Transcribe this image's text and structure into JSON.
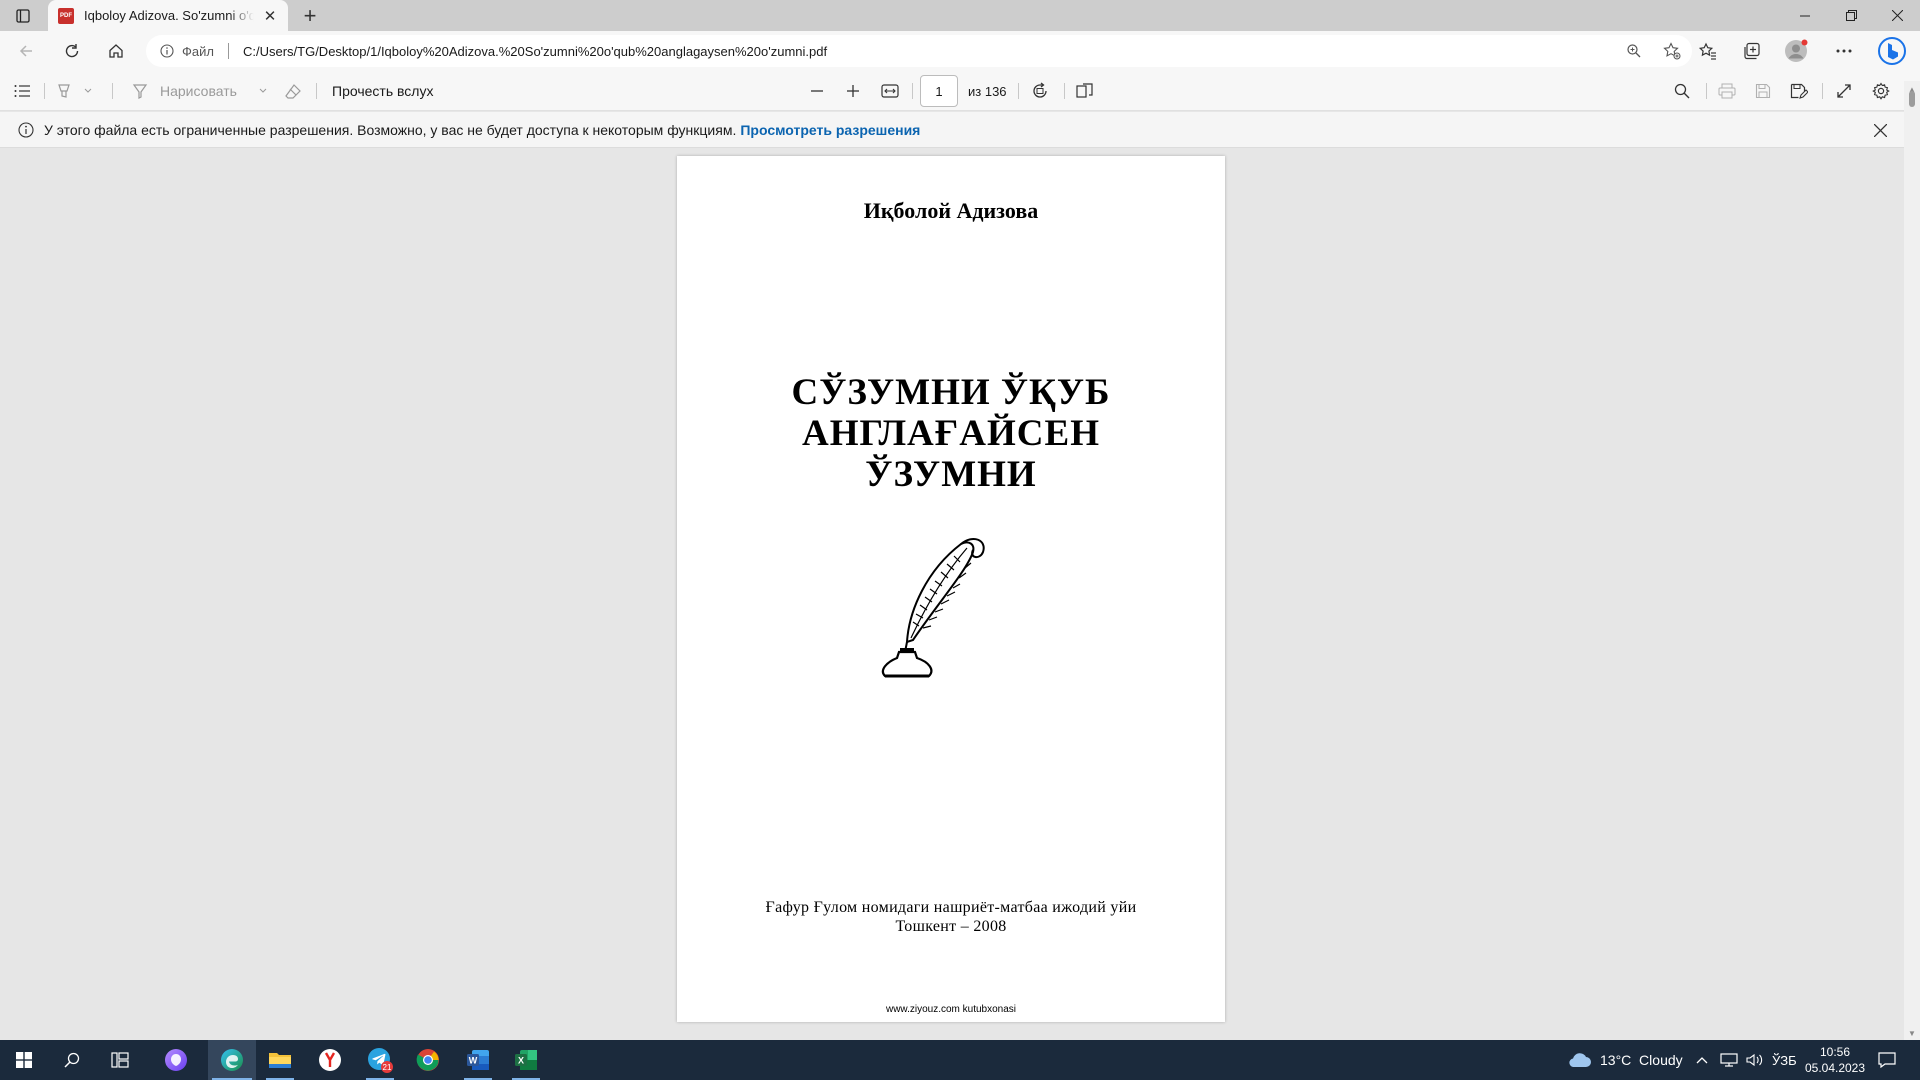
{
  "browser": {
    "tab_title": "Iqboloy Adizova. So'zumni o'qub anglagaysen o'zumni.pdf",
    "tab_icon_text": "PDF",
    "addr_label": "Файл",
    "url": "C:/Users/TG/Desktop/1/Iqboloy%20Adizova.%20So'zumni%20o'qub%20anglagaysen%20o'zumni.pdf",
    "colors": {
      "profile_dot": "#e53935",
      "bing": "#1a73e8"
    }
  },
  "pdf_toolbar": {
    "draw_label": "Нарисовать",
    "read_aloud_label": "Прочесть вслух",
    "page_current": "1",
    "page_total_label": "из 136"
  },
  "infobar": {
    "message": "У этого файла есть ограниченные разрешения. Возможно, у вас не будет доступа к некоторым функциям.",
    "link": "Просмотреть разрешения"
  },
  "document": {
    "author": "Иқболой Адизова",
    "title_lines": [
      "СЎЗУМНИ ЎҚУБ",
      "АНГЛАҒАЙСЕН",
      "ЎЗУМНИ"
    ],
    "publisher_line1": "Ғафур Ғулом номидаги нашриёт-матбаа ижодий уйи",
    "publisher_line2": "Тошкент – 2008",
    "footer": "www.ziyouz.com kutubxonasi"
  },
  "taskbar": {
    "apps": [
      "start-icon",
      "search-icon",
      "task-view-icon",
      "alice-icon",
      "edge-icon",
      "file-explorer-icon",
      "yandex-browser-icon",
      "telegram-icon",
      "chrome-icon",
      "word-icon",
      "excel-icon"
    ],
    "telegram_badge": "21",
    "weather": "13°C  Cloudy",
    "language": "ЎЗБ",
    "time": "10:56",
    "date": "05.04.2023",
    "colors": {
      "excel": "#1d7044",
      "word": "#2b579a",
      "alice": "#8a5cf6"
    }
  }
}
